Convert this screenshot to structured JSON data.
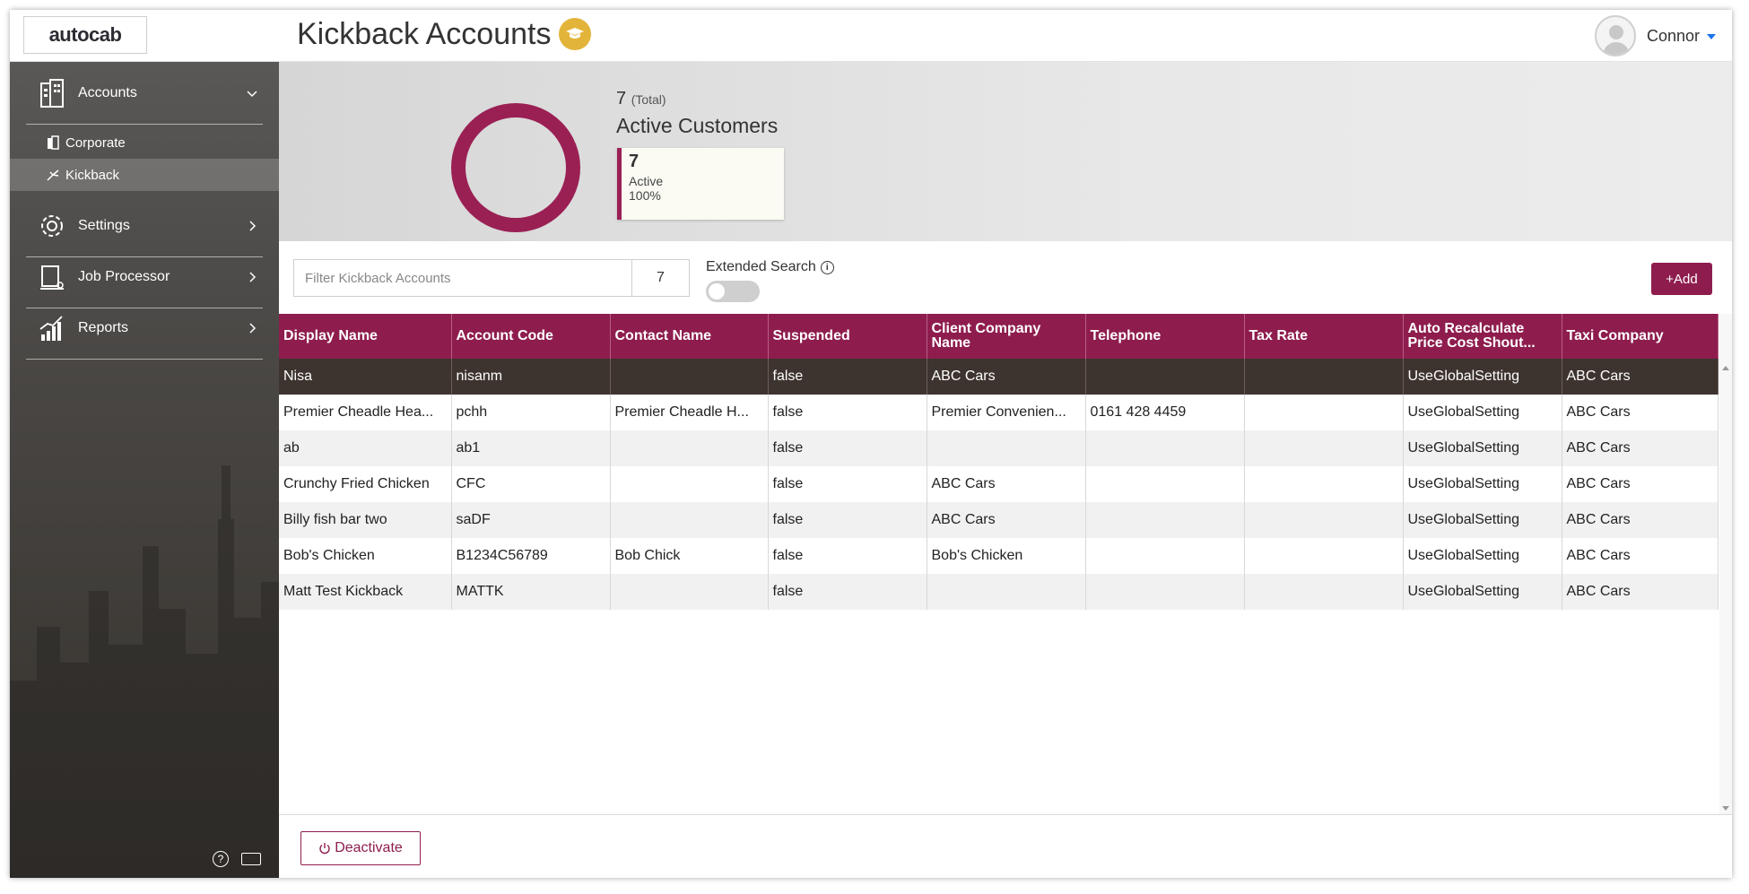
{
  "header": {
    "logo": "autocab",
    "page_title": "Kickback Accounts",
    "user_name": "Connor"
  },
  "sidebar": {
    "sections": [
      {
        "label": "Accounts",
        "icon": "building-icon",
        "expanded": true
      },
      {
        "label": "Settings",
        "icon": "gear-icon",
        "expanded": false
      },
      {
        "label": "Job Processor",
        "icon": "job-processor-icon",
        "expanded": false
      },
      {
        "label": "Reports",
        "icon": "chart-icon",
        "expanded": false
      }
    ],
    "sub_items": [
      {
        "label": "Corporate",
        "icon": "corporate-icon",
        "active": false
      },
      {
        "label": "Kickback",
        "icon": "kickback-icon",
        "active": true
      }
    ]
  },
  "summary": {
    "total": "7",
    "total_label": "(Total)",
    "heading": "Active Customers",
    "card_count": "7",
    "card_label": "Active",
    "card_percent": "100%",
    "donut_color": "#9a2054"
  },
  "toolbar": {
    "filter_placeholder": "Filter Kickback Accounts",
    "filter_count": "7",
    "extended_search": "Extended Search",
    "extended_search_enabled": false,
    "add_label": "Add"
  },
  "table": {
    "columns": [
      "Display Name",
      "Account Code",
      "Contact Name",
      "Suspended",
      "Client Company Name",
      "Telephone",
      "Tax Rate",
      "Auto Recalculate Price Cost Shout...",
      "Taxi Company"
    ],
    "rows": [
      [
        "Nisa",
        "nisanm",
        "",
        "false",
        "ABC Cars",
        "",
        "",
        "UseGlobalSetting",
        "ABC Cars"
      ],
      [
        "Premier Cheadle Hea...",
        "pchh",
        "Premier Cheadle H...",
        "false",
        "Premier Convenien...",
        "0161 428 4459",
        "",
        "UseGlobalSetting",
        "ABC Cars"
      ],
      [
        "ab",
        "ab1",
        "",
        "false",
        "",
        "",
        "",
        "UseGlobalSetting",
        "ABC Cars"
      ],
      [
        "Crunchy Fried Chicken",
        "CFC",
        "",
        "false",
        "ABC Cars",
        "",
        "",
        "UseGlobalSetting",
        "ABC Cars"
      ],
      [
        "Billy fish bar two",
        "saDF",
        "",
        "false",
        "ABC Cars",
        "",
        "",
        "UseGlobalSetting",
        "ABC Cars"
      ],
      [
        "Bob's Chicken",
        "B1234C56789",
        "Bob Chick",
        "false",
        "Bob's Chicken",
        "",
        "",
        "UseGlobalSetting",
        "ABC Cars"
      ],
      [
        "Matt Test Kickback",
        "MATTK",
        "",
        "false",
        "",
        "",
        "",
        "UseGlobalSetting",
        "ABC Cars"
      ]
    ],
    "selected_row": 0
  },
  "footer": {
    "deactivate_label": "Deactivate"
  },
  "colors": {
    "accent": "#8e1d4e",
    "selected_row": "#3e342f",
    "badge": "#e3b43a"
  }
}
